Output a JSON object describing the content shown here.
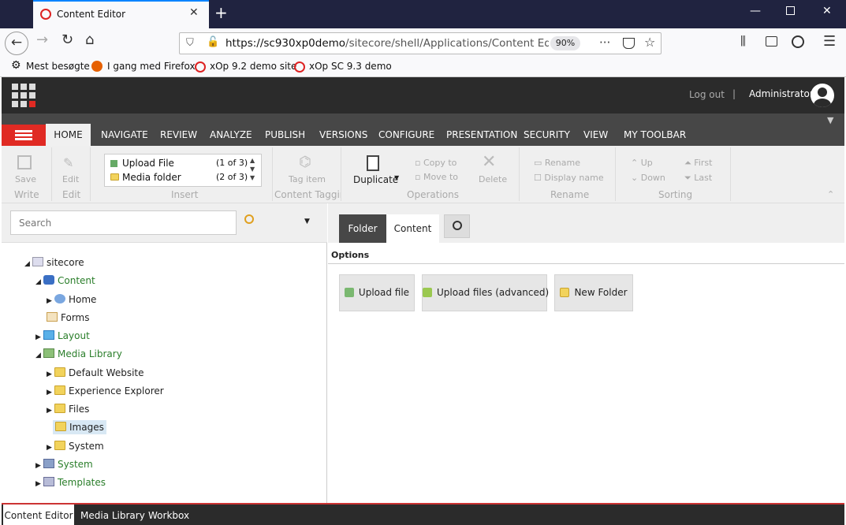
{
  "browser": {
    "tab_title": "Content Editor",
    "tab_close": "✕",
    "new_tab": "+",
    "url_host": "https://sc930xp0demo",
    "url_path": "/sitecore/shell/Applications/Content Ed",
    "zoom": "90%",
    "bookmarks": [
      "Mest besøgte",
      "I gang med Firefox",
      "xOp 9.2 demo site",
      "xOp SC 9.3 demo"
    ]
  },
  "header": {
    "logout": "Log out",
    "separator": "|",
    "user": "Administrator"
  },
  "ribbon_tabs": [
    "HOME",
    "NAVIGATE",
    "REVIEW",
    "ANALYZE",
    "PUBLISH",
    "VERSIONS",
    "CONFIGURE",
    "PRESENTATION",
    "SECURITY",
    "VIEW",
    "MY TOOLBAR"
  ],
  "ribbon": {
    "save": "Save",
    "write": "Write",
    "edit": "Edit",
    "edit_group": "Edit",
    "insert_items": [
      {
        "label": "Upload File",
        "count": "(1 of 3)"
      },
      {
        "label": "Media folder",
        "count": "(2 of 3)"
      }
    ],
    "insert_group": "Insert",
    "tag_item": "Tag item",
    "content_tagging": "Content Tagging",
    "duplicate": "Duplicate",
    "copy_to": "Copy to",
    "move_to": "Move to",
    "delete": "Delete",
    "operations": "Operations",
    "rename": "Rename",
    "display_name": "Display name",
    "rename_group": "Rename",
    "up": "Up",
    "down": "Down",
    "first": "First",
    "last": "Last",
    "sorting": "Sorting"
  },
  "search": {
    "placeholder": "Search"
  },
  "tree": [
    {
      "label": "sitecore",
      "green": false
    },
    {
      "label": "Content",
      "green": true
    },
    {
      "label": "Home",
      "green": false
    },
    {
      "label": "Forms",
      "green": false
    },
    {
      "label": "Layout",
      "green": true
    },
    {
      "label": "Media Library",
      "green": true
    },
    {
      "label": "Default Website",
      "green": false
    },
    {
      "label": "Experience Explorer",
      "green": false
    },
    {
      "label": "Files",
      "green": false
    },
    {
      "label": "Images",
      "green": false
    },
    {
      "label": "System",
      "green": false
    },
    {
      "label": "System",
      "green": true
    },
    {
      "label": "Templates",
      "green": true
    }
  ],
  "editor": {
    "tab_folder": "Folder",
    "tab_content": "Content",
    "options_label": "Options",
    "buttons": [
      "Upload file",
      "Upload files (advanced)",
      "New Folder"
    ]
  },
  "bottom_tabs": [
    "Content Editor",
    "Media Library",
    "Workbox"
  ],
  "colors": {
    "accent_red": "#e02a23",
    "tree_green": "#2a7e2a",
    "dark": "#2b2b2b"
  }
}
